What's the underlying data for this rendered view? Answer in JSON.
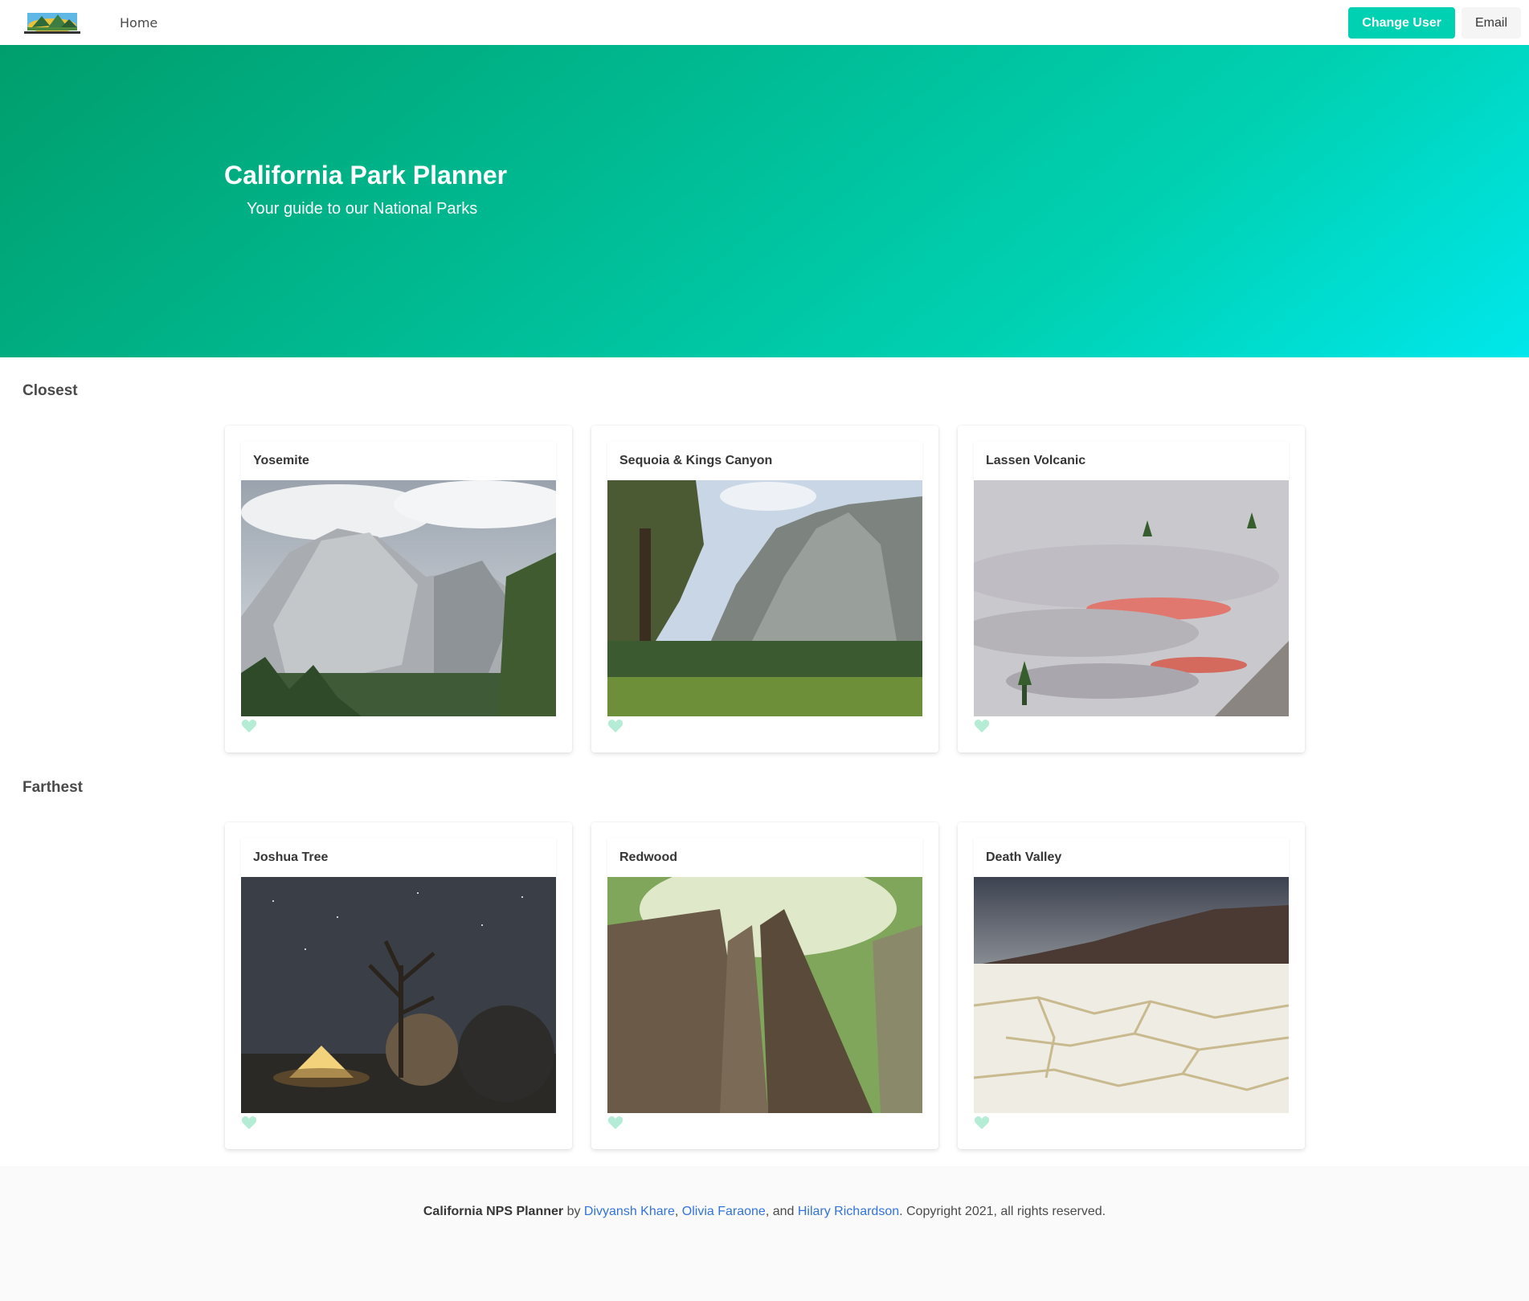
{
  "nav": {
    "home_label": "Home",
    "change_user_label": "Change User",
    "email_label": "Email"
  },
  "hero": {
    "title": "California Park Planner",
    "subtitle": "Your guide to our National Parks"
  },
  "sections": {
    "closest": {
      "title": "Closest",
      "parks": [
        {
          "name": "Yosemite"
        },
        {
          "name": "Sequoia & Kings Canyon"
        },
        {
          "name": "Lassen Volcanic"
        }
      ]
    },
    "farthest": {
      "title": "Farthest",
      "parks": [
        {
          "name": "Joshua Tree"
        },
        {
          "name": "Redwood"
        },
        {
          "name": "Death Valley"
        }
      ]
    }
  },
  "footer": {
    "app_name": "California NPS Planner",
    "by": " by ",
    "author1": "Divyansh Khare",
    "sep1": ", ",
    "author2": "Olivia Faraone",
    "sep2": ", and ",
    "author3": "Hilary Richardson",
    "copyright": ". Copyright 2021, all rights reserved."
  },
  "colors": {
    "primary": "#00d1b2",
    "hero_start": "#009e6c",
    "hero_end": "#00e7eb",
    "link": "#3273dc",
    "heart": "#b5ecd6"
  },
  "icons": {
    "heart": "heart-icon",
    "logo": "park-planner-logo"
  }
}
